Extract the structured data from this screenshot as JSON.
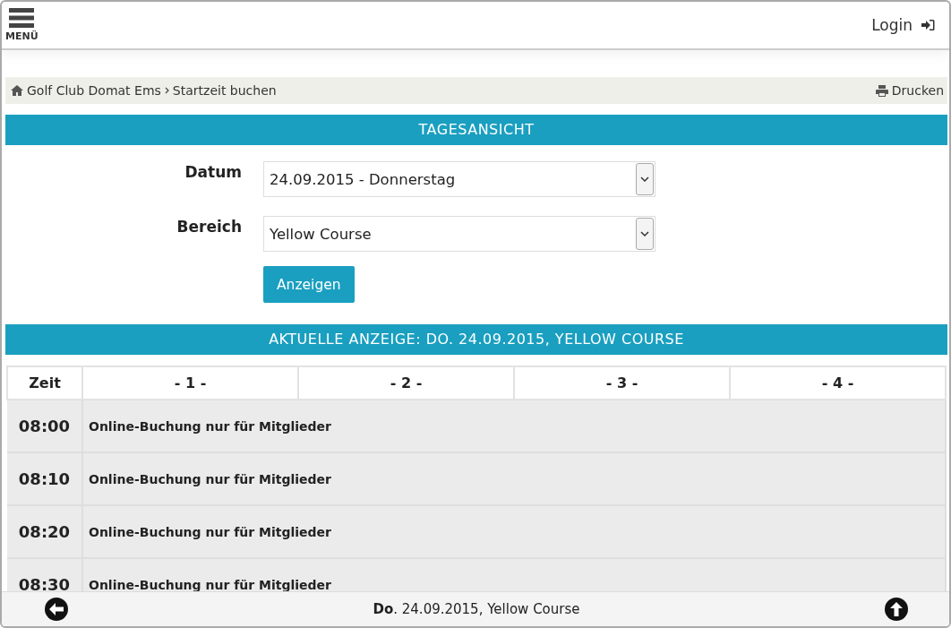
{
  "header": {
    "menu_label": "MENÜ",
    "login_label": "Login"
  },
  "breadcrumb": {
    "items": [
      "Golf Club Domat Ems",
      "Startzeit buchen"
    ],
    "print_label": "Drucken"
  },
  "day_view": {
    "title": "TAGESANSICHT",
    "fields": [
      {
        "label": "Datum",
        "value": "24.09.2015 - Donnerstag"
      },
      {
        "label": "Bereich",
        "value": "Yellow Course"
      }
    ],
    "submit_label": "Anzeigen"
  },
  "schedule": {
    "title": "AKTUELLE ANZEIGE: DO. 24.09.2015, YELLOW COURSE",
    "columns": [
      "Zeit",
      "- 1 -",
      "- 2 -",
      "- 3 -",
      "- 4 -"
    ],
    "rows": [
      {
        "time": "08:00",
        "note": "Online-Buchung nur für Mitglieder"
      },
      {
        "time": "08:10",
        "note": "Online-Buchung nur für Mitglieder"
      },
      {
        "time": "08:20",
        "note": "Online-Buchung nur für Mitglieder"
      },
      {
        "time": "08:30",
        "note": "Online-Buchung nur für Mitglieder"
      }
    ]
  },
  "footer": {
    "text": "**Do**. 24.09.2015, Yellow Course"
  }
}
